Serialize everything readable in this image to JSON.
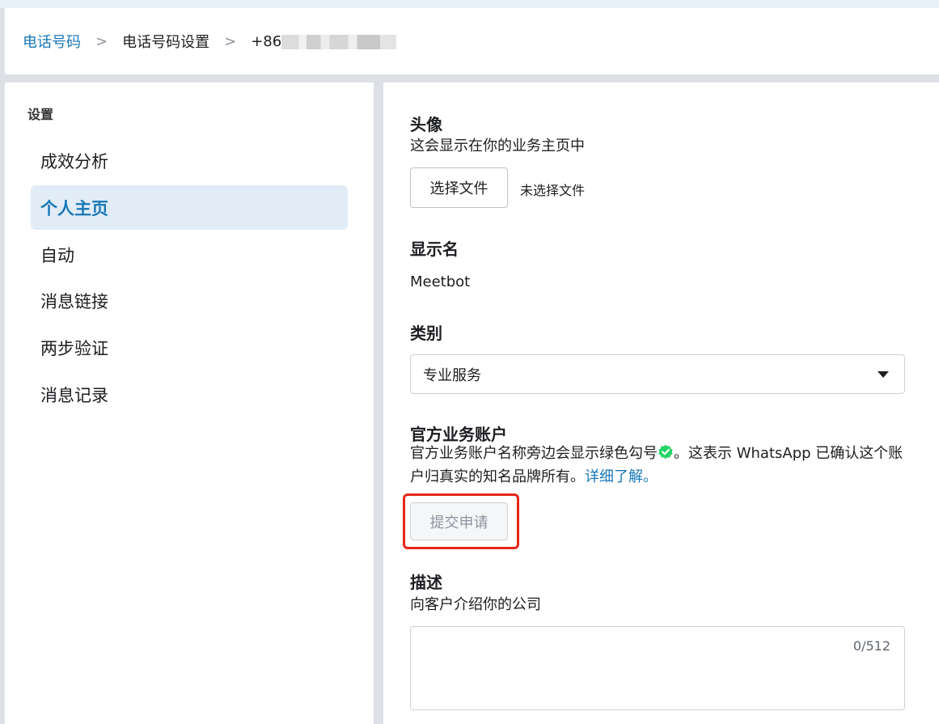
{
  "breadcrumb": {
    "items": [
      "电话号码",
      "电话号码设置",
      "+86"
    ],
    "separator": ">"
  },
  "sidebar": {
    "title": "设置",
    "items": [
      {
        "label": "成效分析",
        "active": false
      },
      {
        "label": "个人主页",
        "active": true
      },
      {
        "label": "自动",
        "active": false
      },
      {
        "label": "消息链接",
        "active": false
      },
      {
        "label": "两步验证",
        "active": false
      },
      {
        "label": "消息记录",
        "active": false
      }
    ]
  },
  "profile": {
    "avatar": {
      "heading": "头像",
      "description": "这会显示在你的业务主页中",
      "choose_file_label": "选择文件",
      "file_status": "未选择文件"
    },
    "display_name": {
      "heading": "显示名",
      "value": "Meetbot"
    },
    "category": {
      "heading": "类别",
      "selected": "专业服务"
    },
    "official_account": {
      "heading": "官方业务账户",
      "text_before": "官方业务账户名称旁边会显示绿色勾号",
      "text_after": "。这表示 WhatsApp 已确认这个账户归真实的知名品牌所有。",
      "learn_more": "详细了解。",
      "submit_label": "提交申请"
    },
    "description": {
      "heading": "描述",
      "subtitle": "向客户介绍你的公司",
      "counter": "0/512"
    }
  },
  "colors": {
    "accent": "#1877b7",
    "active_bg": "#e1ecf7",
    "verified_green": "#25d366",
    "highlight_red": "#e8261b"
  }
}
